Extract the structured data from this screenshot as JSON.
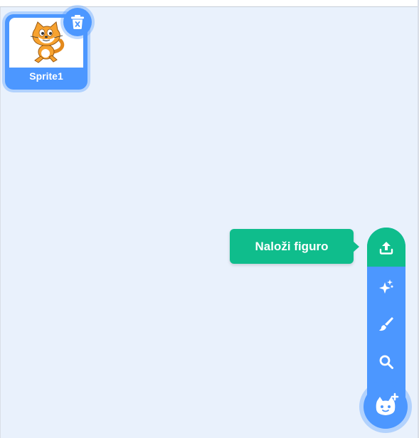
{
  "sprite": {
    "name": "Sprite1"
  },
  "icons": {
    "sprite_thumbnail": "cat-sprite-icon",
    "delete": "trash-icon",
    "upload": "upload-icon",
    "surprise": "sparkle-icon",
    "paint": "paintbrush-icon",
    "search": "search-icon",
    "choose_sprite": "cat-add-icon"
  },
  "menu": {
    "tooltip": "Naloži figuro"
  },
  "colors": {
    "accent": "#4c97ff",
    "upload_green": "#0fbd8c",
    "background": "#e9f1fc"
  }
}
